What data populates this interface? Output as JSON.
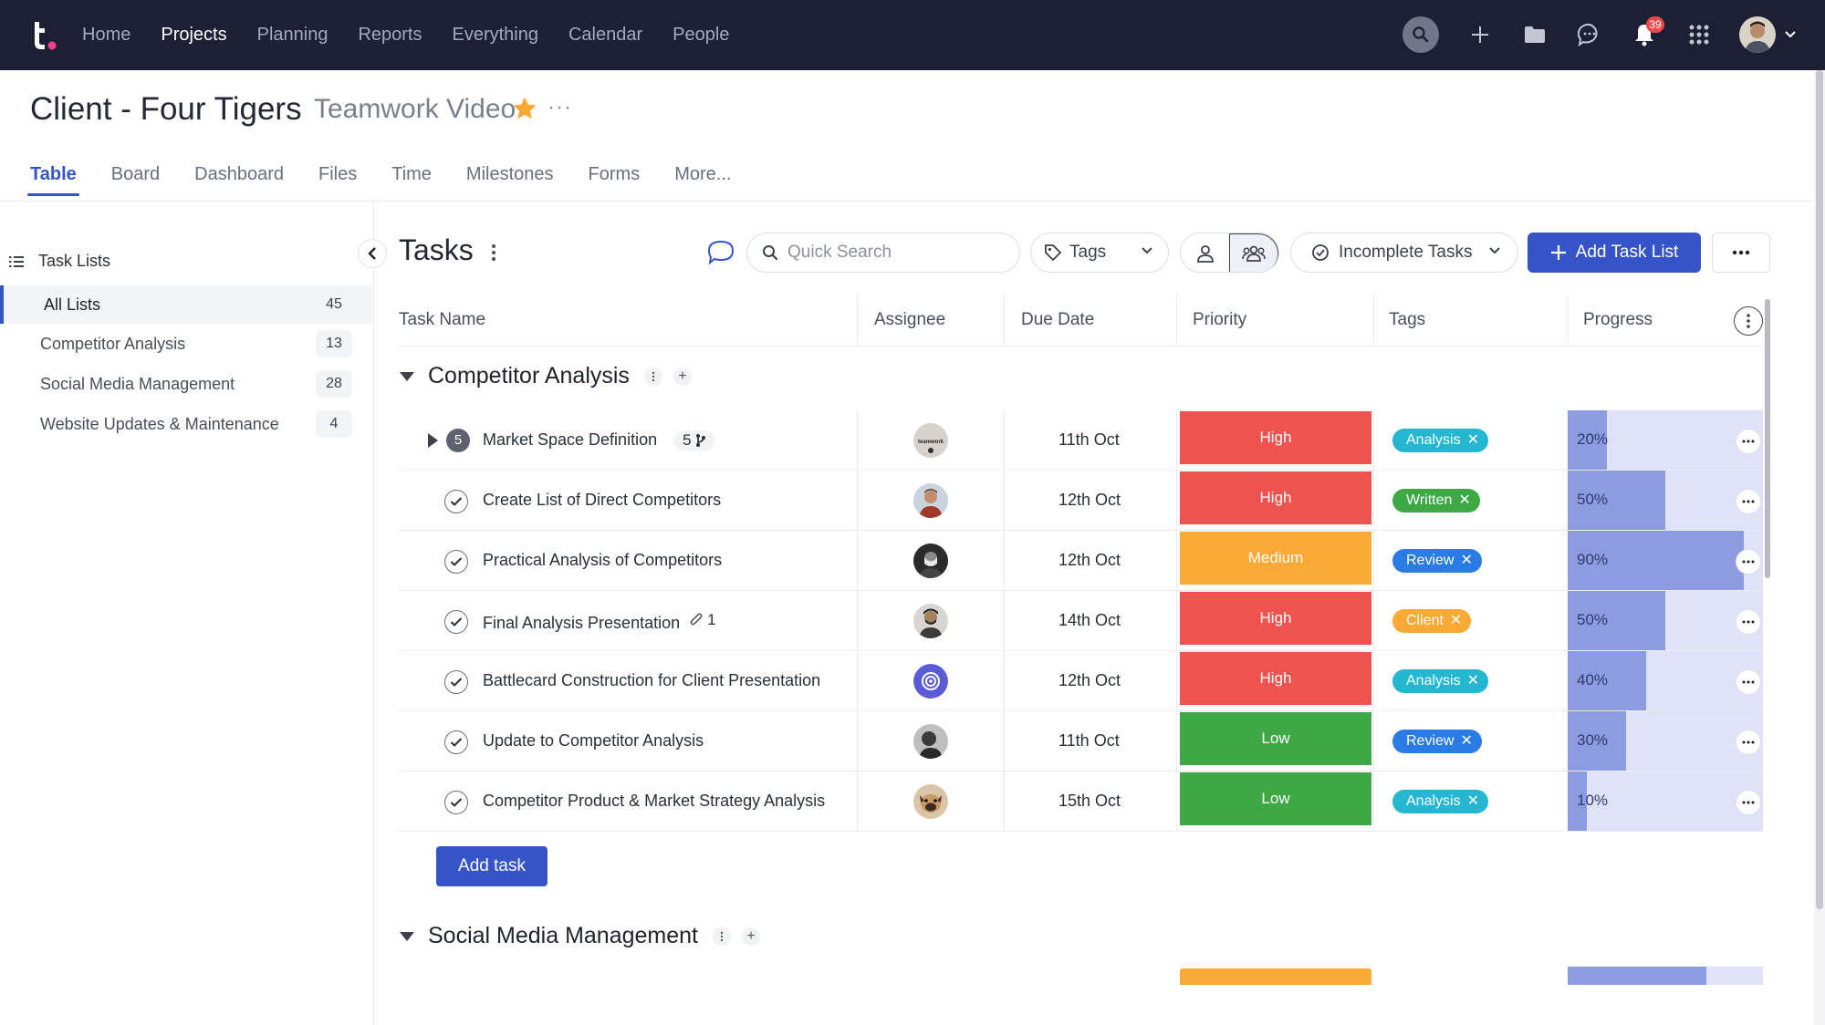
{
  "nav": {
    "links": [
      "Home",
      "Projects",
      "Planning",
      "Reports",
      "Everything",
      "Calendar",
      "People"
    ],
    "active": "Projects",
    "notification_count": "39",
    "icons": [
      "search-icon",
      "plus-icon",
      "folder-icon",
      "chat-icon",
      "bell-icon",
      "apps-grid-icon",
      "avatar",
      "chevron-down-icon"
    ]
  },
  "project": {
    "title": "Client - Four Tigers",
    "subtitle": "Teamwork Video",
    "more": "···"
  },
  "tabs": [
    "Table",
    "Board",
    "Dashboard",
    "Files",
    "Time",
    "Milestones",
    "Forms",
    "More..."
  ],
  "sidebar": {
    "heading": "Task Lists",
    "items": [
      {
        "label": "All Lists",
        "count": "45"
      },
      {
        "label": "Competitor Analysis",
        "count": "13"
      },
      {
        "label": "Social Media Management",
        "count": "28"
      },
      {
        "label": "Website Updates & Maintenance",
        "count": "4"
      }
    ]
  },
  "toolbar": {
    "title": "Tasks",
    "search_placeholder": "Quick Search",
    "tags_label": "Tags",
    "filter_label": "Incomplete Tasks",
    "add_list_label": "Add Task List"
  },
  "columns": [
    "Task Name",
    "Assignee",
    "Due Date",
    "Priority",
    "Tags",
    "Progress"
  ],
  "groups": [
    {
      "name": "Competitor Analysis",
      "tasks": [
        {
          "name": "Market Space Definition",
          "subtasks": "5",
          "meta": "5",
          "due": "11th Oct",
          "priority": "High",
          "tag": "Analysis",
          "progress": 20,
          "progress_label": "20%",
          "assignee_style": "teamwork"
        },
        {
          "name": "Create List of Direct Competitors",
          "due": "12th Oct",
          "priority": "High",
          "tag": "Written",
          "progress": 50,
          "progress_label": "50%",
          "assignee_style": "person-a"
        },
        {
          "name": "Practical Analysis of Competitors",
          "due": "12th Oct",
          "priority": "Medium",
          "tag": "Review",
          "progress": 90,
          "progress_label": "90%",
          "assignee_style": "person-b"
        },
        {
          "name": "Final Analysis Presentation",
          "attachments": "1",
          "due": "14th Oct",
          "priority": "High",
          "tag": "Client",
          "progress": 50,
          "progress_label": "50%",
          "assignee_style": "person-c"
        },
        {
          "name": "Battlecard Construction for Client Presentation",
          "due": "12th Oct",
          "priority": "High",
          "tag": "Analysis",
          "progress": 40,
          "progress_label": "40%",
          "assignee_style": "target"
        },
        {
          "name": "Update to Competitor Analysis",
          "due": "11th Oct",
          "priority": "Low",
          "tag": "Review",
          "progress": 30,
          "progress_label": "30%",
          "assignee_style": "person-d"
        },
        {
          "name": "Competitor Product & Market Strategy Analysis",
          "due": "15th Oct",
          "priority": "Low",
          "tag": "Analysis",
          "progress": 10,
          "progress_label": "10%",
          "assignee_style": "dog"
        }
      ]
    },
    {
      "name": "Social Media Management",
      "tasks": []
    }
  ],
  "add_task_label": "Add task",
  "colors": {
    "nav_bg": "#1d1f35",
    "accent": "#3554c7",
    "priority_high": "#ef5350",
    "priority_medium": "#f9a935",
    "priority_low": "#3ea845",
    "tag_analysis": "#25b6d2",
    "tag_written": "#3ea845",
    "tag_review": "#2a7be4",
    "tag_client": "#f9a935",
    "progress_track": "#dfe3f9",
    "progress_fill": "#8d9ce0"
  }
}
